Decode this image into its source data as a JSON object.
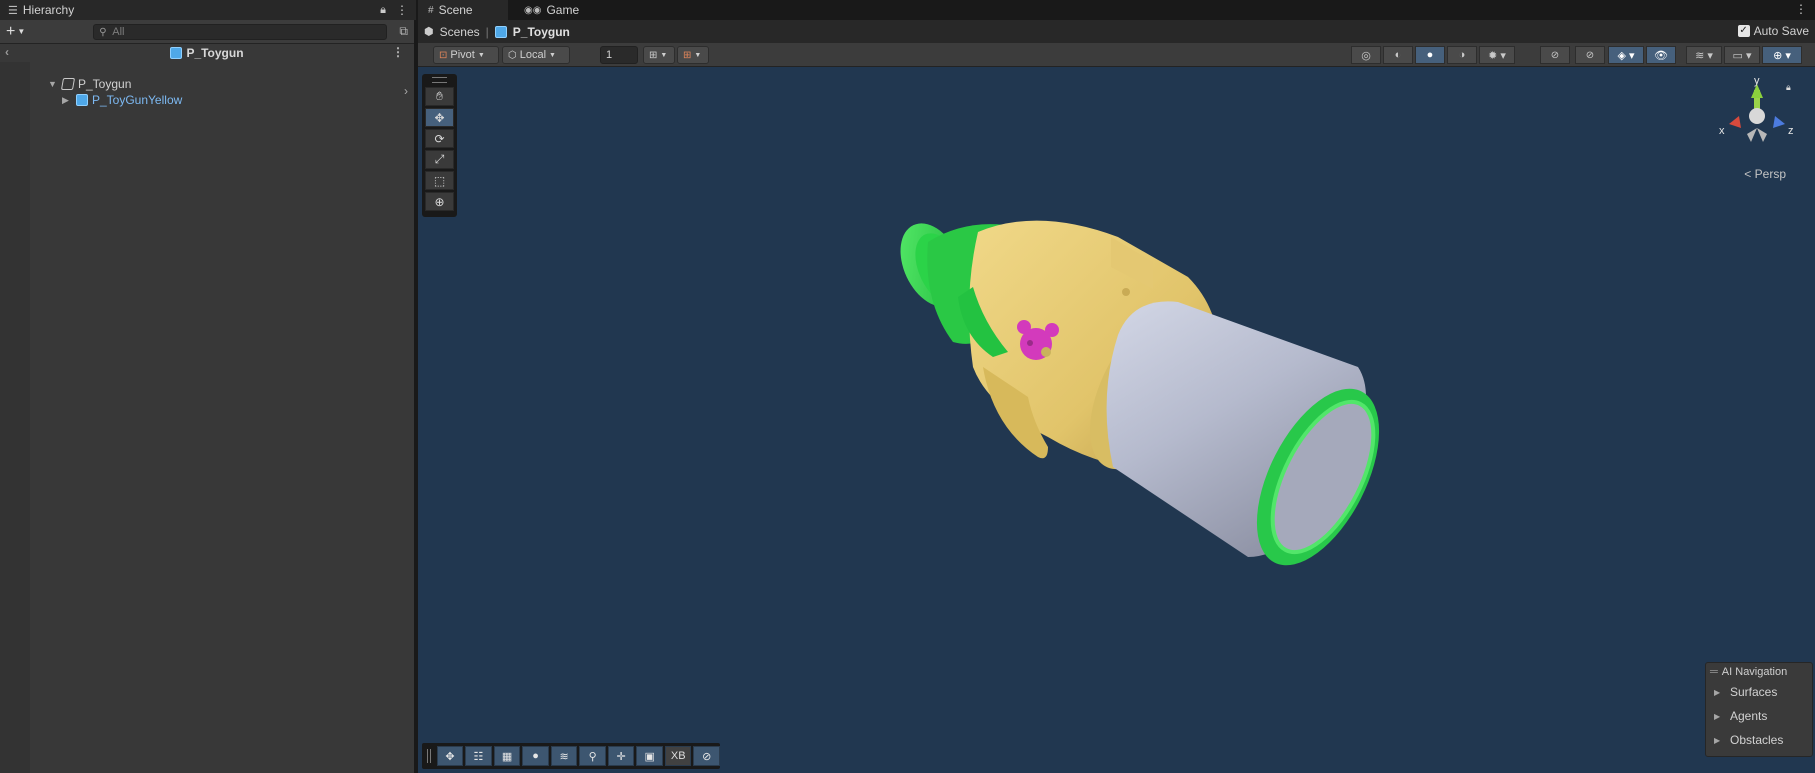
{
  "hierarchy": {
    "tab_title": "Hierarchy",
    "add_label": "+",
    "search_placeholder": "All",
    "scene_title": "P_Toygun",
    "tree": [
      {
        "label": "P_Toygun"
      },
      {
        "label": "P_ToyGunYellow"
      }
    ]
  },
  "scene": {
    "tabs": [
      {
        "label": "Scene"
      },
      {
        "label": "Game"
      }
    ],
    "breadcrumb": {
      "root": "Scenes",
      "current": "P_Toygun"
    },
    "auto_save": {
      "label": "Auto Save",
      "checked": true
    },
    "toolbar": {
      "pivot": "Pivot",
      "space": "Local",
      "grid_value": "1"
    },
    "gizmo": {
      "y": "y",
      "x": "x",
      "z": "z",
      "projection": "Persp"
    },
    "ai_navigation": {
      "title": "AI Navigation",
      "items": [
        "Surfaces",
        "Agents",
        "Obstacles"
      ]
    },
    "bottom_toolbar": {
      "xb_label": "XB"
    }
  },
  "colors": {
    "viewport_bg": "#213750",
    "accent": "#46607c",
    "toy_body": "#e3c870",
    "toy_green": "#31d64e",
    "toy_barrel": "#b8bdd0",
    "sticker": "#d135b8"
  }
}
